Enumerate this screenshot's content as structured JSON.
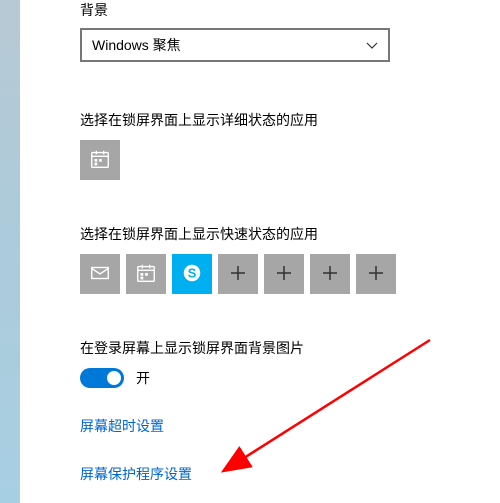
{
  "background": {
    "label": "背景",
    "dropdown_value": "Windows 聚焦"
  },
  "detailed_status": {
    "label": "选择在锁屏界面上显示详细状态的应用",
    "tiles": [
      {
        "name": "calendar-icon"
      }
    ]
  },
  "quick_status": {
    "label": "选择在锁屏界面上显示快速状态的应用",
    "tiles": [
      {
        "name": "mail-icon"
      },
      {
        "name": "calendar-icon"
      },
      {
        "name": "skype-icon"
      },
      {
        "name": "plus-icon"
      },
      {
        "name": "plus-icon"
      },
      {
        "name": "plus-icon"
      },
      {
        "name": "plus-icon"
      }
    ]
  },
  "signin_bg": {
    "label": "在登录屏幕上显示锁屏界面背景图片",
    "toggle_state": "开"
  },
  "links": {
    "timeout": "屏幕超时设置",
    "screensaver": "屏幕保护程序设置"
  }
}
